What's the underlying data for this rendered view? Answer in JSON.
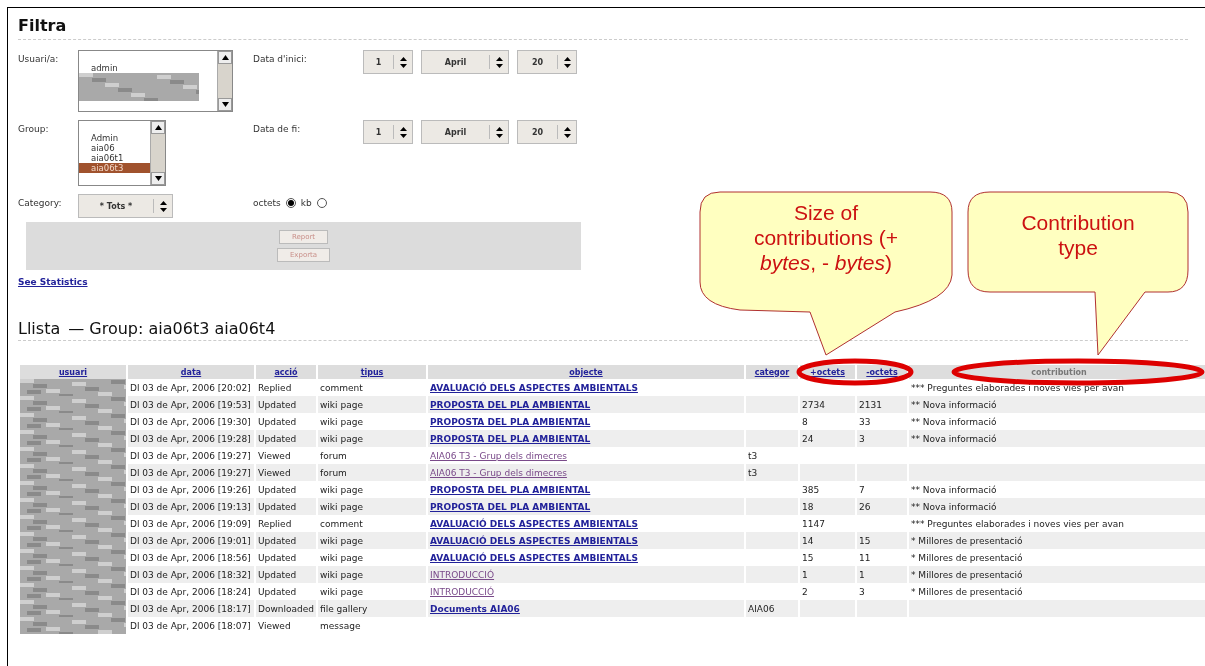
{
  "filter": {
    "title": "Filtra",
    "user_label": "Usuari/a:",
    "user_options": [
      {
        "label": "admin",
        "selected": false
      }
    ],
    "start_label": "Data d'inici:",
    "start": {
      "day": "1",
      "month": "April",
      "year": "20"
    },
    "group_label": "Group:",
    "group_options": [
      {
        "label": "Admin",
        "selected": false
      },
      {
        "label": "aia06",
        "selected": false
      },
      {
        "label": "aia06t1",
        "selected": false
      },
      {
        "label": "aia06t3",
        "selected": true
      }
    ],
    "end_label": "Data de fi:",
    "end": {
      "day": "1",
      "month": "April",
      "year": "20"
    },
    "category_label": "Category:",
    "category": "* Tots *",
    "units": [
      {
        "label": "octets",
        "selected": true
      },
      {
        "label": "kb",
        "selected": false
      }
    ],
    "buttons": [
      "Report",
      "Exporta"
    ],
    "stats_link": "See Statistics"
  },
  "list": {
    "title": "Llista",
    "subtitle": "— Group: aia06t3 aia06t4",
    "columns": [
      "usuari",
      "data",
      "acció",
      "tipus",
      "objecte",
      "categor",
      "+octets",
      "-octets",
      "contribution"
    ],
    "rows": [
      {
        "data": "Dl 03 de Apr, 2006 [20:02]",
        "accio": "Replied",
        "tipus": "comment",
        "objecte": "AVALUACIÓ DELS ASPECTES AMBIENTALS",
        "visited": false,
        "categ": "",
        "plus": "",
        "minus": "",
        "contribution": "*** Preguntes elaborades i noves vies per avan"
      },
      {
        "data": "Dl 03 de Apr, 2006 [19:53]",
        "accio": "Updated",
        "tipus": "wiki page",
        "objecte": "PROPOSTA DEL PLA AMBIENTAL",
        "visited": false,
        "categ": "",
        "plus": "2734",
        "minus": "2131",
        "contribution": "** Nova informació"
      },
      {
        "data": "Dl 03 de Apr, 2006 [19:30]",
        "accio": "Updated",
        "tipus": "wiki page",
        "objecte": "PROPOSTA DEL PLA AMBIENTAL",
        "visited": false,
        "categ": "",
        "plus": "8",
        "minus": "33",
        "contribution": "** Nova informació"
      },
      {
        "data": "Dl 03 de Apr, 2006 [19:28]",
        "accio": "Updated",
        "tipus": "wiki page",
        "objecte": "PROPOSTA DEL PLA AMBIENTAL",
        "visited": false,
        "categ": "",
        "plus": "24",
        "minus": "3",
        "contribution": "** Nova informació"
      },
      {
        "data": "Dl 03 de Apr, 2006 [19:27]",
        "accio": "Viewed",
        "tipus": "forum",
        "objecte": "AIA06 T3 - Grup dels dimecres",
        "visited": true,
        "categ": "t3",
        "plus": "",
        "minus": "",
        "contribution": ""
      },
      {
        "data": "Dl 03 de Apr, 2006 [19:27]",
        "accio": "Viewed",
        "tipus": "forum",
        "objecte": "AIA06 T3 - Grup dels dimecres",
        "visited": true,
        "categ": "t3",
        "plus": "",
        "minus": "",
        "contribution": ""
      },
      {
        "data": "Dl 03 de Apr, 2006 [19:26]",
        "accio": "Updated",
        "tipus": "wiki page",
        "objecte": "PROPOSTA DEL PLA AMBIENTAL",
        "visited": false,
        "categ": "",
        "plus": "385",
        "minus": "7",
        "contribution": "** Nova informació"
      },
      {
        "data": "Dl 03 de Apr, 2006 [19:13]",
        "accio": "Updated",
        "tipus": "wiki page",
        "objecte": "PROPOSTA DEL PLA AMBIENTAL",
        "visited": false,
        "categ": "",
        "plus": "18",
        "minus": "26",
        "contribution": "** Nova informació"
      },
      {
        "data": "Dl 03 de Apr, 2006 [19:09]",
        "accio": "Replied",
        "tipus": "comment",
        "objecte": "AVALUACIÓ DELS ASPECTES AMBIENTALS",
        "visited": false,
        "categ": "",
        "plus": "1147",
        "minus": "",
        "contribution": "*** Preguntes elaborades i noves vies per avan"
      },
      {
        "data": "Dl 03 de Apr, 2006 [19:01]",
        "accio": "Updated",
        "tipus": "wiki page",
        "objecte": "AVALUACIÓ DELS ASPECTES AMBIENTALS",
        "visited": false,
        "categ": "",
        "plus": "14",
        "minus": "15",
        "contribution": "* Millores de presentació"
      },
      {
        "data": "Dl 03 de Apr, 2006 [18:56]",
        "accio": "Updated",
        "tipus": "wiki page",
        "objecte": "AVALUACIÓ DELS ASPECTES AMBIENTALS",
        "visited": false,
        "categ": "",
        "plus": "15",
        "minus": "11",
        "contribution": "* Millores de presentació"
      },
      {
        "data": "Dl 03 de Apr, 2006 [18:32]",
        "accio": "Updated",
        "tipus": "wiki page",
        "objecte": "INTRODUCCIÓ",
        "visited": true,
        "categ": "",
        "plus": "1",
        "minus": "1",
        "contribution": "* Millores de presentació"
      },
      {
        "data": "Dl 03 de Apr, 2006 [18:24]",
        "accio": "Updated",
        "tipus": "wiki page",
        "objecte": "INTRODUCCIÓ",
        "visited": true,
        "categ": "",
        "plus": "2",
        "minus": "3",
        "contribution": "* Millores de presentació"
      },
      {
        "data": "Dl 03 de Apr, 2006 [18:17]",
        "accio": "Downloaded",
        "tipus": "file gallery",
        "objecte": "Documents AIA06",
        "visited": false,
        "categ": "AIA06",
        "plus": "",
        "minus": "",
        "contribution": ""
      },
      {
        "data": "Dl 03 de Apr, 2006 [18:07]",
        "accio": "Viewed",
        "tipus": "message",
        "objecte": "",
        "categ": "",
        "plus": "",
        "minus": "",
        "contribution": ""
      }
    ]
  },
  "callouts": [
    {
      "text": "Size of contributions (+ *bytes*, - *bytes*)"
    },
    {
      "text": "Contribution type"
    }
  ]
}
